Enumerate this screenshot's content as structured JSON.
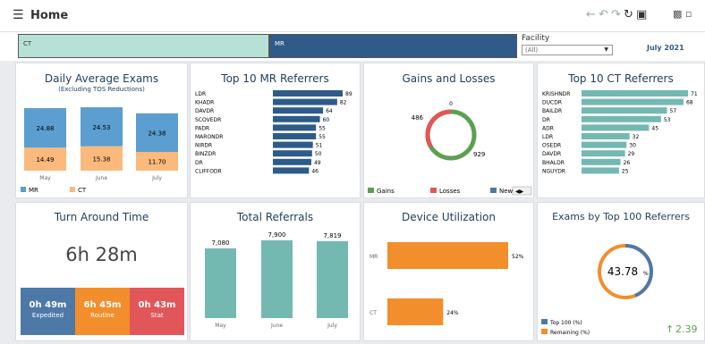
{
  "header": {
    "title": "Home"
  },
  "filter": {
    "ct_label": "CT",
    "mr_label": "MR",
    "facility_label": "Facility",
    "facility_value": "(All)",
    "month": "July 2021"
  },
  "colors": {
    "mr": "#5b9ecf",
    "ct": "#fbb97c",
    "teal": "#74b8b2",
    "navy": "#2e5b8a",
    "orange": "#f28e2b",
    "green": "#59a14f",
    "red": "#e15759",
    "expedited": "#4e79a7",
    "stat": "#e15759"
  },
  "daily": {
    "title": "Daily Average Exams",
    "subtitle": "(Excluding TOS Reductions)",
    "legend_mr": "MR",
    "legend_ct": "CT",
    "chart_data": {
      "type": "bar",
      "categories": [
        "May",
        "June",
        "July"
      ],
      "series": [
        {
          "name": "MR",
          "values": [
            24.88,
            24.53,
            24.38
          ]
        },
        {
          "name": "CT",
          "values": [
            14.49,
            15.38,
            11.7
          ]
        }
      ]
    },
    "labels_mr": [
      "24.88",
      "24.53",
      "24.38"
    ],
    "labels_ct": [
      "14.49",
      "15.38",
      "11.70"
    ]
  },
  "mr_ref": {
    "title": "Top 10 MR Referrers",
    "chart_data": {
      "type": "bar",
      "categories": [
        "LDR",
        "KHADR",
        "DAVDR",
        "SCOVEDR",
        "PADR",
        "MARONDR",
        "NIRDR",
        "BINZDR",
        "DR",
        "CLIFFODR"
      ],
      "values": [
        89,
        82,
        64,
        60,
        55,
        55,
        51,
        50,
        49,
        46
      ]
    }
  },
  "gains": {
    "title": "Gains and Losses",
    "chart_data": {
      "type": "pie",
      "labels": [
        "Gains",
        "Losses",
        "New"
      ],
      "values": [
        929,
        486,
        0
      ]
    },
    "label_new": "0",
    "label_losses": "486",
    "label_gains": "929",
    "legend": [
      "Gains",
      "Losses",
      "New"
    ]
  },
  "ct_ref": {
    "title": "Top 10 CT Referrers",
    "chart_data": {
      "type": "bar",
      "categories": [
        "KRISHNDR",
        "DUCDR",
        "BAILDR",
        "DR",
        "ADR",
        "LDR",
        "OSEDR",
        "DAVDR",
        "BHALDR",
        "NGUYDR"
      ],
      "values": [
        71,
        68,
        57,
        53,
        45,
        32,
        30,
        29,
        26,
        25
      ]
    }
  },
  "tat": {
    "title": "Turn Around Time",
    "value": "6h 28m",
    "tiles": [
      {
        "value": "0h 49m",
        "label": "Expedited"
      },
      {
        "value": "6h 45m",
        "label": "Routine"
      },
      {
        "value": "0h 43m",
        "label": "Stat"
      }
    ]
  },
  "referrals": {
    "title": "Total Referrals",
    "chart_data": {
      "type": "bar",
      "categories": [
        "May",
        "June",
        "July"
      ],
      "values": [
        7080,
        7900,
        7819
      ]
    },
    "labels": [
      "7,080",
      "7,900",
      "7,819"
    ]
  },
  "device": {
    "title": "Device Utilization",
    "chart_data": {
      "type": "bar",
      "categories": [
        "MR",
        "CT"
      ],
      "values": [
        52,
        24
      ]
    },
    "labels": [
      "52%",
      "24%"
    ]
  },
  "exams100": {
    "title": "Exams by Top 100 Referrers",
    "chart_data": {
      "type": "pie",
      "labels": [
        "Top 100 (%)",
        "Remaining (%)"
      ],
      "values": [
        43.78,
        56.22
      ]
    },
    "center_value": "43.78",
    "center_unit": "%",
    "legend": [
      "Top 100 (%)",
      "Remaining (%)"
    ],
    "change": "2.39"
  }
}
